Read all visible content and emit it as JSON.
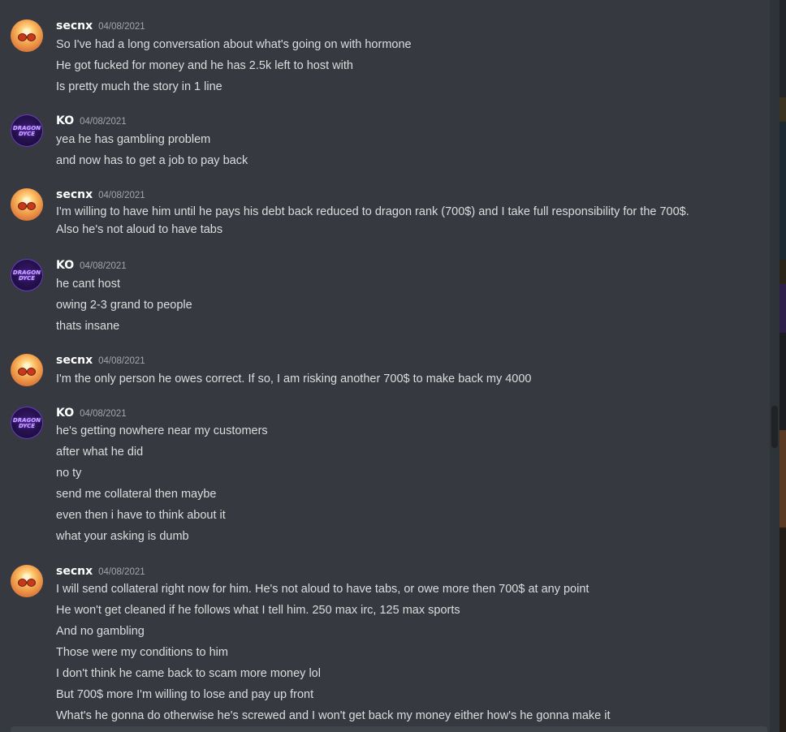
{
  "messages": [
    {
      "user": "secnx",
      "timestamp": "04/08/2021",
      "avatar": "sunset-sunglasses",
      "lines": [
        "So I've had a long conversation about what's going on with hormone",
        "He got fucked for money and he has 2.5k left to host with",
        "Is pretty much the story in 1 line"
      ]
    },
    {
      "user": "KO",
      "timestamp": "04/08/2021",
      "avatar": "dragon-dyce",
      "avatar_text": "DRAGON DYCE",
      "lines": [
        "yea he has gambling problem",
        "and  now has to get a job to pay back"
      ]
    },
    {
      "user": "secnx",
      "timestamp": "04/08/2021",
      "avatar": "sunset-sunglasses",
      "lines": [
        "I'm willing to have him until he pays his debt back reduced to dragon rank (700$) and I take full responsibility for the 700$.",
        "Also he's not aloud to have tabs"
      ]
    },
    {
      "user": "KO",
      "timestamp": "04/08/2021",
      "avatar": "dragon-dyce",
      "avatar_text": "DRAGON DYCE",
      "lines": [
        "he cant host",
        "owing 2-3 grand to people",
        "thats insane"
      ]
    },
    {
      "user": "secnx",
      "timestamp": "04/08/2021",
      "avatar": "sunset-sunglasses",
      "lines": [
        "I'm the only person he owes correct. If so, I am risking another 700$ to make back my 4000"
      ]
    },
    {
      "user": "KO",
      "timestamp": "04/08/2021",
      "avatar": "dragon-dyce",
      "avatar_text": "DRAGON DYCE",
      "lines": [
        "he's getting nowhere near my customers",
        "after what he did",
        "no ty",
        "send me collateral then maybe",
        "even then i have to think about it",
        "what your asking is dumb"
      ]
    },
    {
      "user": "secnx",
      "timestamp": "04/08/2021",
      "avatar": "sunset-sunglasses",
      "lines": [
        "I will send collateral right now for him. He's not aloud to have tabs, or owe more then 700$ at any point",
        "He won't get cleaned if he follows what I tell him. 250 max irc, 125 max sports",
        "And no gambling",
        "Those were my conditions to him",
        "I don't think he came back to scam more money lol",
        "But 700$ more I'm willing to lose and pay up front",
        "What's he gonna do otherwise he's screwed and I won't get back my money either how's he gonna make it"
      ]
    }
  ],
  "colors": {
    "background": "#36393f",
    "text": "#dcddde",
    "username": "#ffffff",
    "timestamp": "#a3a6aa",
    "scrollbar_track": "#2e3338",
    "scrollbar_thumb": "#202225"
  }
}
